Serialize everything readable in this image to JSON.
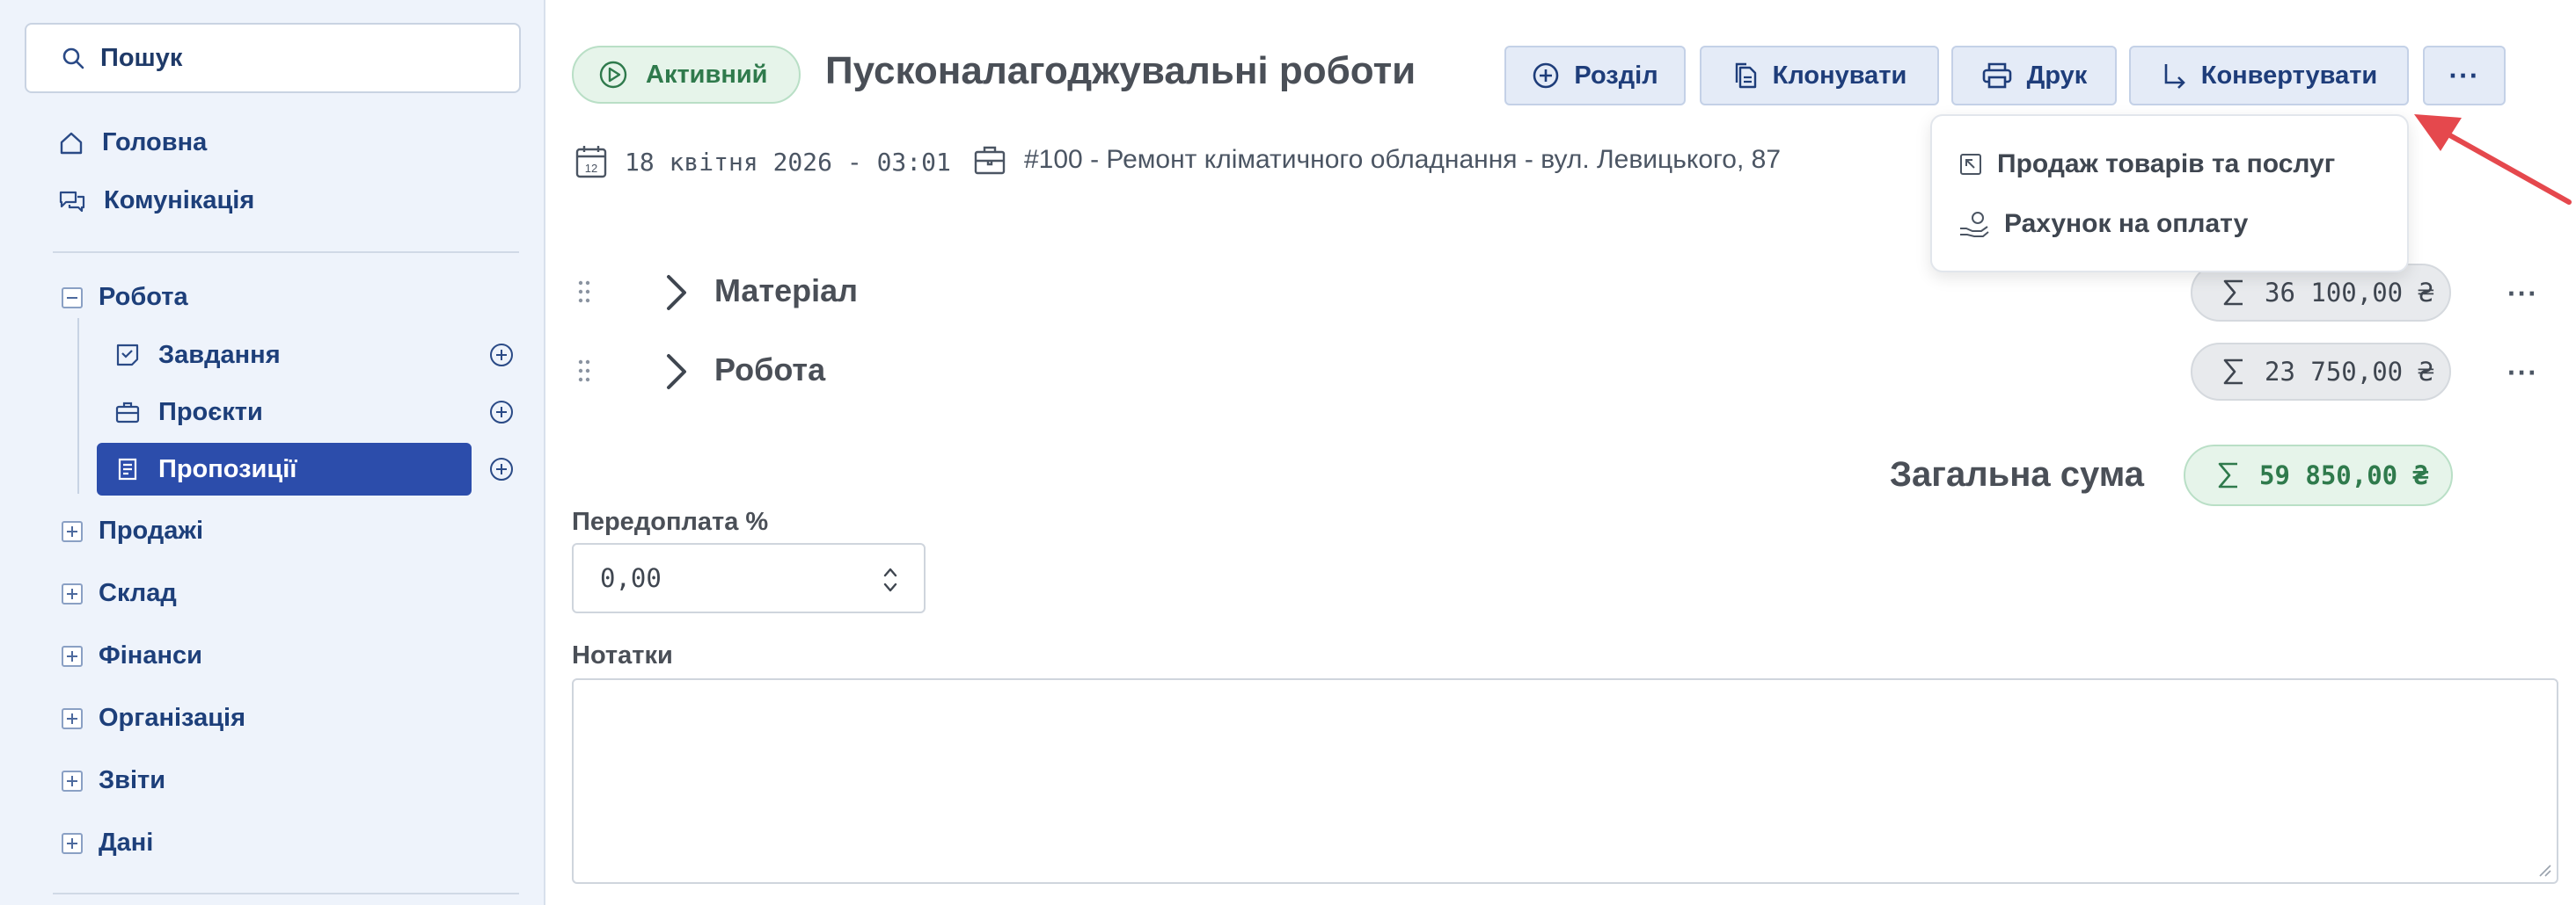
{
  "sidebar": {
    "search": {
      "label": "Пошук",
      "icon": "search-icon"
    },
    "top_items": [
      {
        "label": "Головна",
        "icon": "home-icon"
      },
      {
        "label": "Комунікація",
        "icon": "chat-icon"
      }
    ],
    "work_group": {
      "label": "Робота",
      "expanded": true,
      "items": [
        {
          "label": "Завдання",
          "icon": "tasks-icon",
          "active": false
        },
        {
          "label": "Проєкти",
          "icon": "briefcase-icon",
          "active": false
        },
        {
          "label": "Пропозиції",
          "icon": "proposal-icon",
          "active": true
        }
      ]
    },
    "groups": [
      {
        "label": "Продажі"
      },
      {
        "label": "Склад"
      },
      {
        "label": "Фінанси"
      },
      {
        "label": "Організація"
      },
      {
        "label": "Звіти"
      },
      {
        "label": "Дані"
      }
    ]
  },
  "header": {
    "status": "Активний",
    "title": "Пусконалагоджувальні роботи",
    "buttons": {
      "section": "Розділ",
      "clone": "Клонувати",
      "print": "Друк",
      "convert": "Конвертувати",
      "more": "···"
    },
    "date": "18 квітня 2026 - 03:01",
    "project": "#100 - Ремонт кліматичного обладнання - вул. Левицького, 87",
    "calendar_day": "12"
  },
  "convert_menu": {
    "items": [
      {
        "label": "Продаж товарів та послуг",
        "icon": "sale-icon"
      },
      {
        "label": "Рахунок на оплату",
        "icon": "invoice-hand-icon"
      }
    ]
  },
  "sections": [
    {
      "title": "Матеріал",
      "sum": "36 100,00 ₴",
      "more": "···"
    },
    {
      "title": "Робота",
      "sum": "23 750,00 ₴",
      "more": "···"
    }
  ],
  "total": {
    "label": "Загальна сума",
    "sum": "59 850,00 ₴"
  },
  "prepayment": {
    "label": "Передоплата %",
    "value": "0,00"
  },
  "notes": {
    "label": "Нотатки",
    "value": ""
  },
  "colors": {
    "accent": "#2c4dab",
    "sidebar_bg": "#eef3fb",
    "status_green": "#2f7a4c",
    "arrow_red": "#e5484d"
  }
}
